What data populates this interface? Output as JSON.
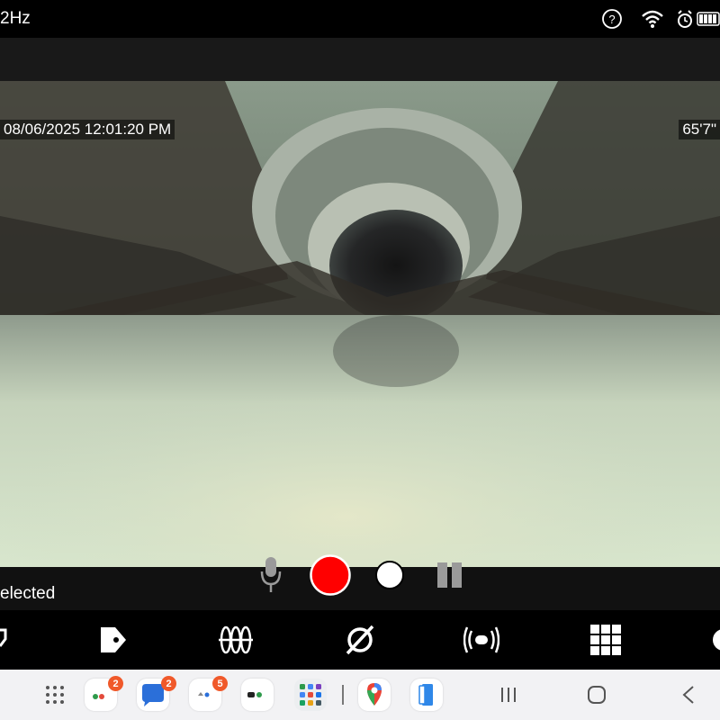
{
  "status_bar": {
    "frequency_text": "2Hz",
    "icons": [
      "help-circle-icon",
      "wifi-icon",
      "alarm-icon",
      "battery-icon"
    ]
  },
  "video": {
    "timestamp": "08/06/2025  12:01:20 PM",
    "distance": "65'7\""
  },
  "controls": {
    "selected_text": "elected",
    "buttons": [
      "microphone-icon",
      "record-button",
      "snapshot-button",
      "pause-button"
    ]
  },
  "toolbar": {
    "items": [
      "partial-icon",
      "tag-icon",
      "pipe-segments-icon",
      "diameter-icon",
      "sonde-icon",
      "grid-icon",
      "settings-icon"
    ]
  },
  "dock": {
    "badges": {
      "app1": "2",
      "messages": "2",
      "app3": "5"
    },
    "nav": [
      "recents-button",
      "home-button",
      "back-button"
    ]
  },
  "colors": {
    "record": "#ff0000",
    "badge": "#f0592a",
    "dock_bg": "#f2f2f4"
  }
}
